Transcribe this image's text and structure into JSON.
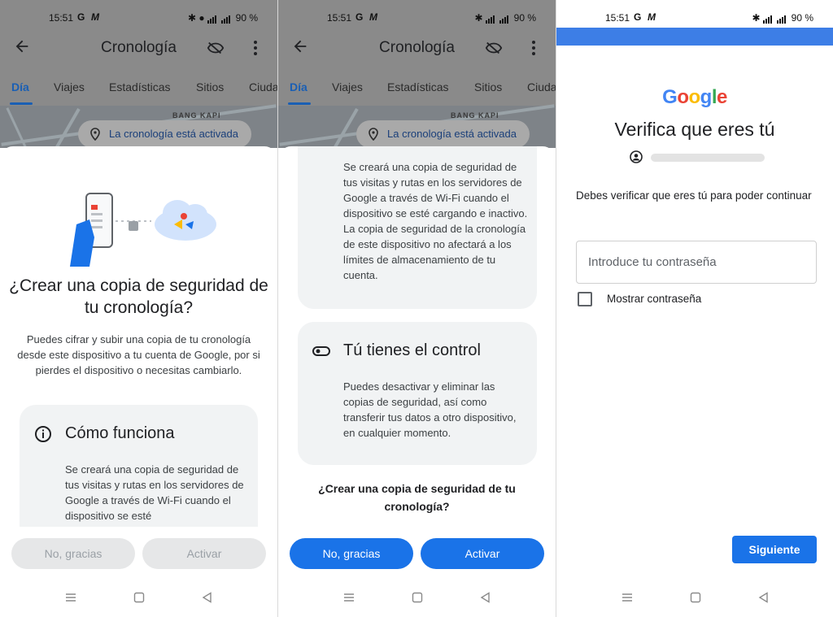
{
  "status_bar": {
    "time": "15:51",
    "battery": "90 %",
    "app_icons": [
      "G",
      "M"
    ]
  },
  "timeline_screen": {
    "title": "Cronología",
    "tabs": [
      "Día",
      "Viajes",
      "Estadísticas",
      "Sitios",
      "Ciuda"
    ],
    "map_label": "BANG KAPI",
    "chip_text": "La cronología está activada"
  },
  "backup_sheet": {
    "heading": "¿Crear una copia de seguridad de tu cronología?",
    "intro": "Puedes cifrar y subir una copia de tu cronología desde este dispositivo a tu cuenta de Google, por si pierdes el dispositivo o necesitas cambiarlo.",
    "how_title": "Cómo funciona",
    "how_text": "Se creará una copia de seguridad de tus visitas y rutas en los servidores de Google a través de Wi-Fi cuando el dispositivo se esté",
    "how_text_full": "Se creará una copia de seguridad de tus visitas y rutas en los servidores de Google a través de Wi-Fi cuando el dispositivo se esté cargando e inactivo. La copia de seguridad de la cronología de este dispositivo no afectará a los límites de almacenamiento de tu cuenta.",
    "control_title": "Tú tienes el control",
    "control_text": "Puedes desactivar y eliminar las copias de seguridad, así como transferir tus datos a otro dispositivo, en cualquier momento.",
    "question": "¿Crear una copia de seguridad de tu cronología?",
    "decline_label": "No, gracias",
    "accept_label": "Activar"
  },
  "verify_screen": {
    "logo_letters": [
      "G",
      "o",
      "o",
      "g",
      "l",
      "e"
    ],
    "logo_colors": [
      "#4285F4",
      "#EA4335",
      "#FBBC05",
      "#4285F4",
      "#34A853",
      "#EA4335"
    ],
    "title": "Verifica que eres tú",
    "message": "Debes verificar que eres tú para poder continuar",
    "password_placeholder": "Introduce tu contraseña",
    "show_password_label": "Mostrar contraseña",
    "next_label": "Siguiente"
  },
  "colors": {
    "primary": "#1a73e8",
    "tab_active": "#1a5fb4",
    "card_bg": "#f1f3f4"
  }
}
